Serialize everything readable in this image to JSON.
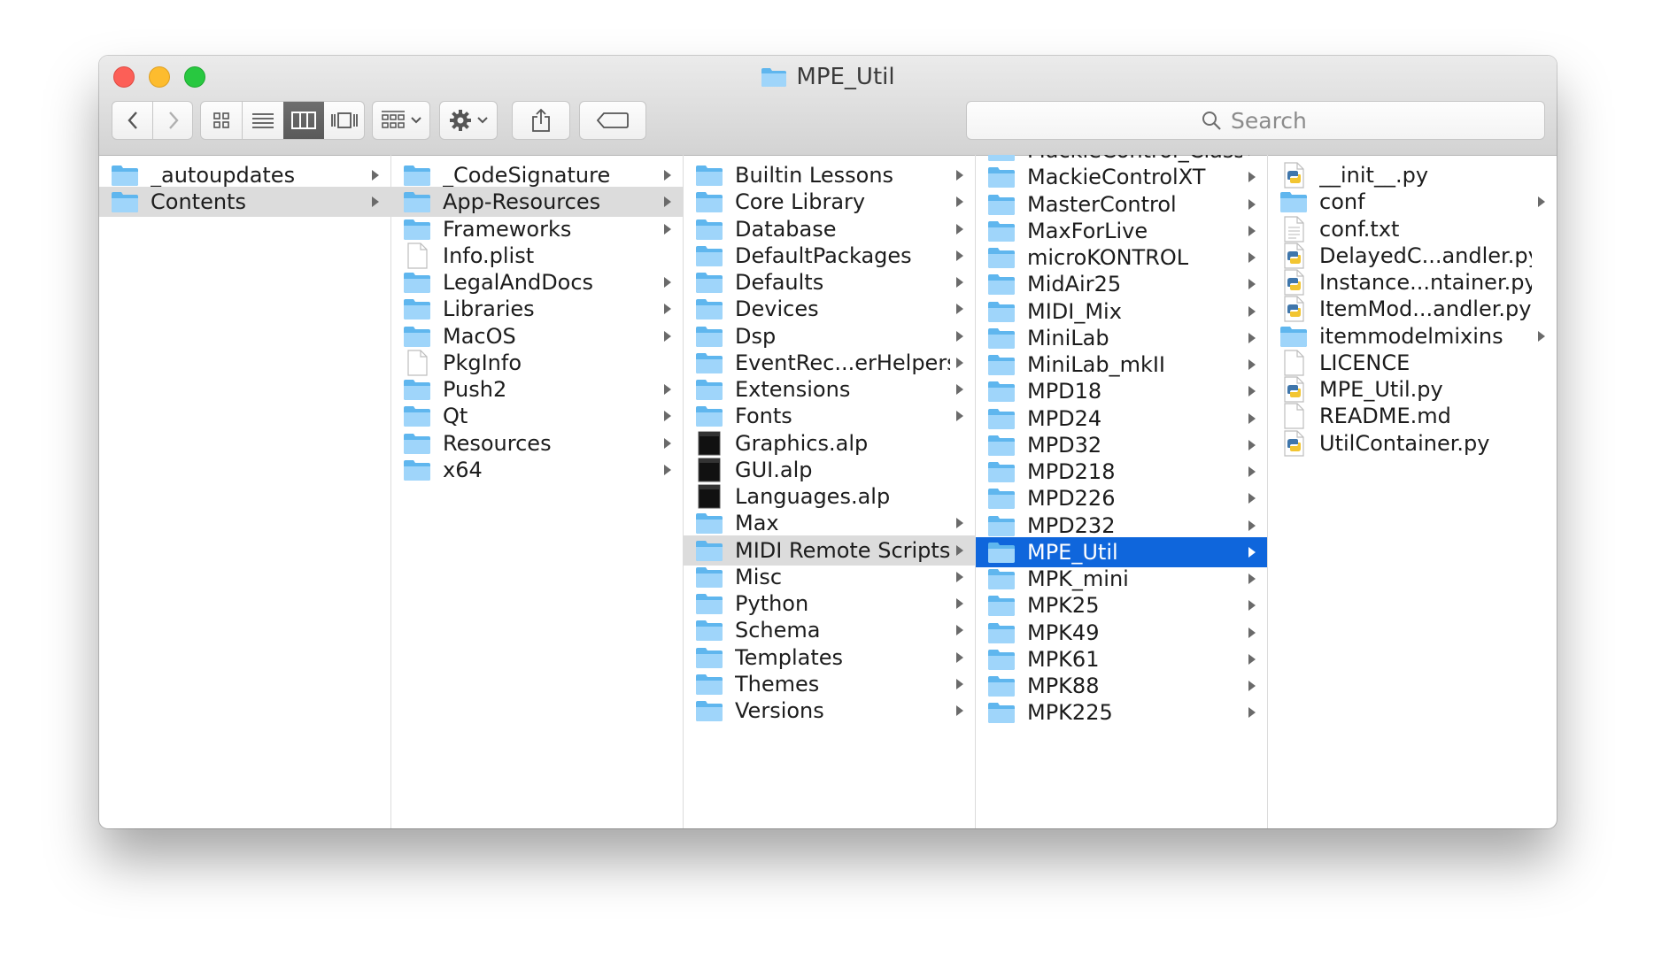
{
  "window": {
    "title": "MPE_Util"
  },
  "toolbar": {
    "back": "back",
    "forward": "forward",
    "view_icon": "icon-view",
    "view_list": "list-view",
    "view_column": "column-view",
    "view_coverflow": "coverflow-view",
    "arrange": "arrange",
    "action": "action",
    "share": "share",
    "tags": "tags"
  },
  "search": {
    "placeholder": "Search"
  },
  "columns": [
    {
      "items": [
        {
          "name": "_autoupdates",
          "type": "folder",
          "arrow": true
        },
        {
          "name": "Contents",
          "type": "folder",
          "arrow": true,
          "selected": "gray"
        }
      ]
    },
    {
      "items": [
        {
          "name": "_CodeSignature",
          "type": "folder",
          "arrow": true
        },
        {
          "name": "App-Resources",
          "type": "folder",
          "arrow": true,
          "selected": "gray"
        },
        {
          "name": "Frameworks",
          "type": "folder",
          "arrow": true
        },
        {
          "name": "Info.plist",
          "type": "file",
          "arrow": false
        },
        {
          "name": "LegalAndDocs",
          "type": "folder",
          "arrow": true
        },
        {
          "name": "Libraries",
          "type": "folder",
          "arrow": true
        },
        {
          "name": "MacOS",
          "type": "folder",
          "arrow": true
        },
        {
          "name": "PkgInfo",
          "type": "file",
          "arrow": false
        },
        {
          "name": "Push2",
          "type": "folder",
          "arrow": true
        },
        {
          "name": "Qt",
          "type": "folder",
          "arrow": true
        },
        {
          "name": "Resources",
          "type": "folder",
          "arrow": true
        },
        {
          "name": "x64",
          "type": "folder",
          "arrow": true
        }
      ]
    },
    {
      "items": [
        {
          "name": "Builtin Lessons",
          "type": "folder",
          "arrow": true
        },
        {
          "name": "Core Library",
          "type": "folder",
          "arrow": true
        },
        {
          "name": "Database",
          "type": "folder",
          "arrow": true
        },
        {
          "name": "DefaultPackages",
          "type": "folder",
          "arrow": true
        },
        {
          "name": "Defaults",
          "type": "folder",
          "arrow": true
        },
        {
          "name": "Devices",
          "type": "folder",
          "arrow": true
        },
        {
          "name": "Dsp",
          "type": "folder",
          "arrow": true
        },
        {
          "name": "EventRec...erHelpers",
          "type": "folder",
          "arrow": true
        },
        {
          "name": "Extensions",
          "type": "folder",
          "arrow": true
        },
        {
          "name": "Fonts",
          "type": "folder",
          "arrow": true
        },
        {
          "name": "Graphics.alp",
          "type": "alp",
          "arrow": false
        },
        {
          "name": "GUI.alp",
          "type": "alp",
          "arrow": false
        },
        {
          "name": "Languages.alp",
          "type": "alp",
          "arrow": false
        },
        {
          "name": "Max",
          "type": "folder",
          "arrow": true
        },
        {
          "name": "MIDI Remote Scripts",
          "type": "folder",
          "arrow": true,
          "selected": "gray"
        },
        {
          "name": "Misc",
          "type": "folder",
          "arrow": true
        },
        {
          "name": "Python",
          "type": "folder",
          "arrow": true
        },
        {
          "name": "Schema",
          "type": "folder",
          "arrow": true
        },
        {
          "name": "Templates",
          "type": "folder",
          "arrow": true
        },
        {
          "name": "Themes",
          "type": "folder",
          "arrow": true
        },
        {
          "name": "Versions",
          "type": "folder",
          "arrow": true
        }
      ]
    },
    {
      "items": [
        {
          "name": "MackieControl_Classic",
          "type": "folder",
          "arrow": true
        },
        {
          "name": "MackieControlXT",
          "type": "folder",
          "arrow": true
        },
        {
          "name": "MasterControl",
          "type": "folder",
          "arrow": true
        },
        {
          "name": "MaxForLive",
          "type": "folder",
          "arrow": true
        },
        {
          "name": "microKONTROL",
          "type": "folder",
          "arrow": true
        },
        {
          "name": "MidAir25",
          "type": "folder",
          "arrow": true
        },
        {
          "name": "MIDI_Mix",
          "type": "folder",
          "arrow": true
        },
        {
          "name": "MiniLab",
          "type": "folder",
          "arrow": true
        },
        {
          "name": "MiniLab_mkII",
          "type": "folder",
          "arrow": true
        },
        {
          "name": "MPD18",
          "type": "folder",
          "arrow": true
        },
        {
          "name": "MPD24",
          "type": "folder",
          "arrow": true
        },
        {
          "name": "MPD32",
          "type": "folder",
          "arrow": true
        },
        {
          "name": "MPD218",
          "type": "folder",
          "arrow": true
        },
        {
          "name": "MPD226",
          "type": "folder",
          "arrow": true
        },
        {
          "name": "MPD232",
          "type": "folder",
          "arrow": true
        },
        {
          "name": "MPE_Util",
          "type": "folder",
          "arrow": true,
          "selected": "blue"
        },
        {
          "name": "MPK_mini",
          "type": "folder",
          "arrow": true
        },
        {
          "name": "MPK25",
          "type": "folder",
          "arrow": true
        },
        {
          "name": "MPK49",
          "type": "folder",
          "arrow": true
        },
        {
          "name": "MPK61",
          "type": "folder",
          "arrow": true
        },
        {
          "name": "MPK88",
          "type": "folder",
          "arrow": true
        },
        {
          "name": "MPK225",
          "type": "folder",
          "arrow": true
        }
      ]
    },
    {
      "items": [
        {
          "name": "__init__.py",
          "type": "python",
          "arrow": false
        },
        {
          "name": "conf",
          "type": "folder",
          "arrow": true
        },
        {
          "name": "conf.txt",
          "type": "text",
          "arrow": false
        },
        {
          "name": "DelayedC...andler.py",
          "type": "python",
          "arrow": false
        },
        {
          "name": "Instance...ntainer.py",
          "type": "python",
          "arrow": false
        },
        {
          "name": "ItemMod...andler.py",
          "type": "python",
          "arrow": false
        },
        {
          "name": "itemmodelmixins",
          "type": "folder",
          "arrow": true
        },
        {
          "name": "LICENCE",
          "type": "file",
          "arrow": false
        },
        {
          "name": "MPE_Util.py",
          "type": "python",
          "arrow": false
        },
        {
          "name": "README.md",
          "type": "file",
          "arrow": false
        },
        {
          "name": "UtilContainer.py",
          "type": "python",
          "arrow": false
        }
      ]
    }
  ]
}
